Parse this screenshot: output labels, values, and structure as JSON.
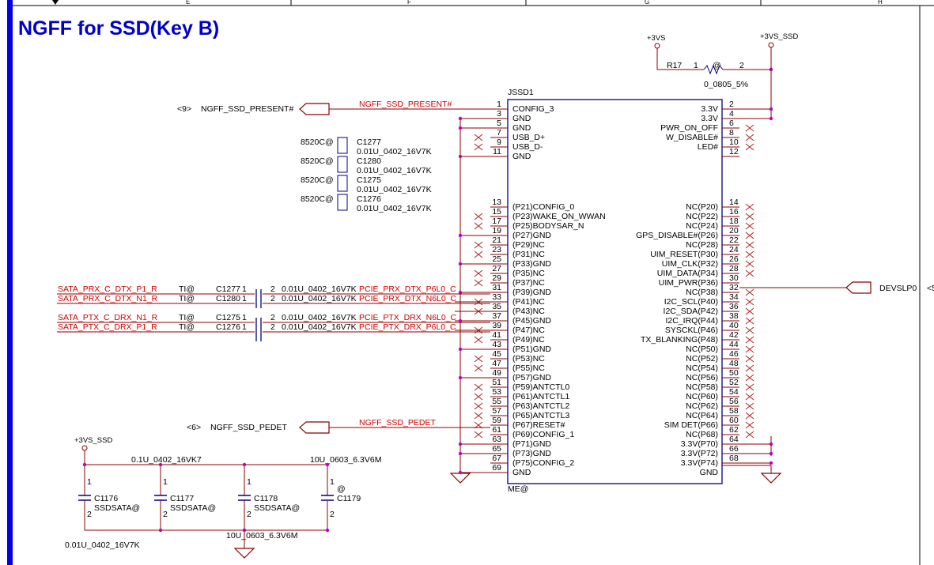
{
  "sheet_title": "NGFF for SSD(Key B)",
  "colors": {
    "wire": "#8b0000",
    "body": "#000080",
    "dot": "#c000c0",
    "noconnect": "#b22222",
    "netlabel": "#cc0000"
  },
  "border_columns": [
    "E",
    "F",
    "G",
    "H"
  ],
  "connector": {
    "ref": "JSSD1",
    "bottom_label": "ME@",
    "left_pins": [
      {
        "num": "1",
        "name": "CONFIG_3"
      },
      {
        "num": "3",
        "name": "GND"
      },
      {
        "num": "5",
        "name": "GND"
      },
      {
        "num": "7",
        "name": "USB_D+"
      },
      {
        "num": "9",
        "name": "USB_D-"
      },
      {
        "num": "11",
        "name": "GND"
      },
      {
        "num": "13",
        "name": "(P21)CONFIG_0"
      },
      {
        "num": "15",
        "name": "(P23)WAKE_ON_WWAN"
      },
      {
        "num": "17",
        "name": "(P25)BODYSAR_N"
      },
      {
        "num": "19",
        "name": "(P27)GND"
      },
      {
        "num": "21",
        "name": "(P29)NC"
      },
      {
        "num": "23",
        "name": "(P31)NC"
      },
      {
        "num": "25",
        "name": "(P33)GND"
      },
      {
        "num": "27",
        "name": "(P35)NC"
      },
      {
        "num": "29",
        "name": "(P37)NC"
      },
      {
        "num": "31",
        "name": "(P39)GND"
      },
      {
        "num": "33",
        "name": "(P41)NC"
      },
      {
        "num": "35",
        "name": "(P43)NC"
      },
      {
        "num": "37",
        "name": "(P45)GND"
      },
      {
        "num": "39",
        "name": "(P47)NC"
      },
      {
        "num": "41",
        "name": "(P49)NC"
      },
      {
        "num": "43",
        "name": "(P51)GND"
      },
      {
        "num": "45",
        "name": "(P53)NC"
      },
      {
        "num": "47",
        "name": "(P55)NC"
      },
      {
        "num": "49",
        "name": "(P57)GND"
      },
      {
        "num": "51",
        "name": "(P59)ANTCTL0"
      },
      {
        "num": "53",
        "name": "(P61)ANTCTL1"
      },
      {
        "num": "55",
        "name": "(P63)ANTCTL2"
      },
      {
        "num": "57",
        "name": "(P65)ANTCTL3"
      },
      {
        "num": "59",
        "name": "(P67)RESET#"
      },
      {
        "num": "61",
        "name": "(P69)CONFIG_1"
      },
      {
        "num": "63",
        "name": "(P71)GND"
      },
      {
        "num": "65",
        "name": "(P73)GND"
      },
      {
        "num": "67",
        "name": "(P75)CONFIG_2"
      },
      {
        "num": "69",
        "name": "GND"
      }
    ],
    "right_pins": [
      {
        "num": "2",
        "name": "3.3V"
      },
      {
        "num": "4",
        "name": "3.3V"
      },
      {
        "num": "6",
        "name": "PWR_ON_OFF"
      },
      {
        "num": "8",
        "name": "W_DISABLE#"
      },
      {
        "num": "10",
        "name": "LED#"
      },
      {
        "num": "12",
        "name": ""
      },
      {
        "num": "14",
        "name": "NC(P20)"
      },
      {
        "num": "16",
        "name": "NC(P22)"
      },
      {
        "num": "18",
        "name": "NC(P24)"
      },
      {
        "num": "20",
        "name": "GPS_DISABLE#(P26)"
      },
      {
        "num": "22",
        "name": "NC(P28)"
      },
      {
        "num": "24",
        "name": "UIM_RESET(P30)"
      },
      {
        "num": "26",
        "name": "UIM_CLK(P32)"
      },
      {
        "num": "28",
        "name": "UIM_DATA(P34)"
      },
      {
        "num": "30",
        "name": "UIM_PWR(P36)"
      },
      {
        "num": "32",
        "name": "NC(P38)"
      },
      {
        "num": "34",
        "name": "I2C_SCL(P40)"
      },
      {
        "num": "36",
        "name": "I2C_SDA(P42)"
      },
      {
        "num": "38",
        "name": "I2C_IRQ(P44)"
      },
      {
        "num": "40",
        "name": "SYSCKL(P46)"
      },
      {
        "num": "42",
        "name": "TX_BLANKING(P48)"
      },
      {
        "num": "44",
        "name": "NC(P50)"
      },
      {
        "num": "46",
        "name": "NC(P52)"
      },
      {
        "num": "48",
        "name": "NC(P54)"
      },
      {
        "num": "50",
        "name": "NC(P56)"
      },
      {
        "num": "52",
        "name": "NC(P58)"
      },
      {
        "num": "54",
        "name": "NC(P60)"
      },
      {
        "num": "56",
        "name": "NC(P62)"
      },
      {
        "num": "58",
        "name": "NC(P64)"
      },
      {
        "num": "60",
        "name": "SIM DET(P66)"
      },
      {
        "num": "62",
        "name": "NC(P68)"
      },
      {
        "num": "64",
        "name": "3.3V(P70)"
      },
      {
        "num": "66",
        "name": "3.3V(P72)"
      },
      {
        "num": "68",
        "name": "3.3V(P74)"
      },
      {
        "num": "",
        "name": "GND"
      }
    ]
  },
  "power": {
    "plus3vs": "+3VS",
    "plus3vs_ssd": "+3VS_SSD",
    "plus3vs_ssd_bottom": "+3VS_SSD"
  },
  "resistor": {
    "ref": "R17",
    "pin1": "1",
    "pin2": "2",
    "mark": "@",
    "value": "0_0805_5%"
  },
  "offpage": {
    "present": {
      "ref": "<9>",
      "net": "NGFF_SSD_PRESENT#",
      "wire_label": "NGFF_SSD_PRESENT#"
    },
    "pedet": {
      "ref": "<6>",
      "net": "NGFF_SSD_PEDET",
      "wire_label": "NGFF_SSD_PEDET"
    },
    "devslp": {
      "net": "DEVSLP0",
      "ref": "<5"
    }
  },
  "cap_legend": [
    {
      "opt": "8520C@",
      "ref": "C1277",
      "value": "0.01U_0402_16V7K"
    },
    {
      "opt": "8520C@",
      "ref": "C1280",
      "value": "0.01U_0402_16V7K"
    },
    {
      "opt": "8520C@",
      "ref": "C1275",
      "value": "0.01U_0402_16V7K"
    },
    {
      "opt": "8520C@",
      "ref": "C1276",
      "value": "0.01U_0402_16V7K"
    }
  ],
  "sata_rows": [
    {
      "left_net": "SATA_PRX_C_DTX_P1_R",
      "opt": "TI@",
      "ref": "C1277",
      "p1": "1",
      "p2": "2",
      "value": "0.01U_0402_16V7K",
      "right_net": "PCIE_PRX_DTX_P6L0_C"
    },
    {
      "left_net": "SATA_PRX_C_DTX_N1_R",
      "opt": "TI@",
      "ref": "C1280",
      "p1": "1",
      "p2": "2",
      "value": "0.01U_0402_16V7K",
      "right_net": "PCIE_PRX_DTX_N6L0_C"
    },
    {
      "left_net": "SATA_PTX_C_DRX_N1_R",
      "opt": "TI@",
      "ref": "C1275",
      "p1": "1",
      "p2": "2",
      "value": "0.01U_0402_16V7K",
      "right_net": "PCIE_PTX_DRX_N6L0_C"
    },
    {
      "left_net": "SATA_PTX_C_DRX_P1_R",
      "opt": "TI@",
      "ref": "C1276",
      "p1": "1",
      "p2": "2",
      "value": "0.01U_0402_16V7K",
      "right_net": "PCIE_PTX_DRX_P6L0_C"
    }
  ],
  "decoupling": {
    "rail": "+3VS_SSD",
    "top_value_left": "0.1U_0402_16VK7",
    "top_value_right": "10U_0603_6.3V6M",
    "bottom_value_left": "0.01U_0402_16V7K",
    "bottom_value_right": "10U_0603_6.3V6M",
    "caps": [
      {
        "ref": "C1176",
        "opt": "SSDSATA@",
        "p1": "1",
        "p2": "2"
      },
      {
        "ref": "C1177",
        "opt": "SSDSATA@",
        "p1": "1",
        "p2": "2"
      },
      {
        "ref": "C1178",
        "opt": "SSDSATA@",
        "p1": "1",
        "p2": "2"
      },
      {
        "ref": "C1179",
        "opt": "@",
        "p1": "1",
        "p2": "2"
      }
    ]
  }
}
